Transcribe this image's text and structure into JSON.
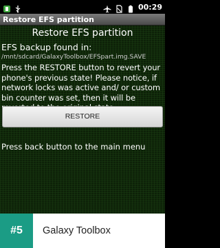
{
  "status_bar": {
    "time": "00:29",
    "icons": [
      "notification-icon",
      "usb-icon",
      "airplane-icon",
      "no-sim-icon",
      "battery-icon"
    ]
  },
  "app": {
    "title": "Restore EFS partition"
  },
  "main": {
    "heading": "Restore EFS partition",
    "found_label": "EFS backup found in:",
    "backup_path": "/mnt/sdcard/GalaxyToolbox/EFSpart.img.SAVE",
    "instructions": "Press the RESTORE button to revert your phone's previous state! Please notice, if network locks was active and/ or custom bin counter was set, then it will be reverted to the original state.",
    "restore_button_label": "RESTORE",
    "back_text": "Press back button to the main menu"
  },
  "ad_bar": {
    "rank": "#5",
    "app_name": "Galaxy Toolbox",
    "accent": "#1b9c85"
  }
}
